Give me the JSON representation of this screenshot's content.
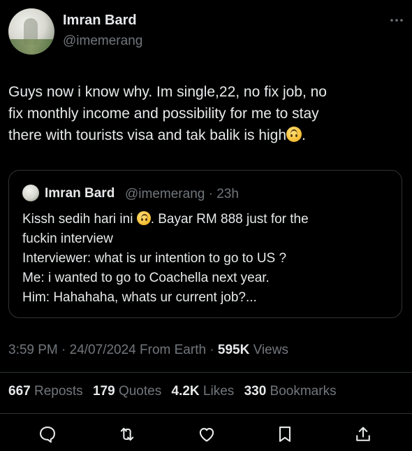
{
  "author": {
    "name": "Imran Bard",
    "handle": "@imemerang"
  },
  "tweet": {
    "lines": [
      "Guys now i know why. Im single,22, no fix job, no",
      "fix monthly income and possibility for me to stay",
      "there with tourists visa and tak balik is high"
    ],
    "line3_tail": ".",
    "emoji": "upside-down-face-emoji"
  },
  "quoted": {
    "name": "Imran Bard",
    "handle_time": "@imemerang · 23h",
    "line1_pre": "Kissh sedih hari ini",
    "line1_post": ". Bayar RM 888 just for the",
    "lines": [
      "fuckin interview",
      "Interviewer: what is ur intention to go to US ?",
      "Me: i wanted to go to Coachella next year.",
      "Him: Hahahaha, whats ur current job?..."
    ]
  },
  "meta": {
    "time_date_source": "3:59 PM · 24/07/2024 From Earth · ",
    "views_count": "595K",
    "views_label": "Views"
  },
  "stats": {
    "reposts_count": "667",
    "reposts_label": "Reposts",
    "quotes_count": "179",
    "quotes_label": "Quotes",
    "likes_count": "4.2K",
    "likes_label": "Likes",
    "bookmarks_count": "330",
    "bookmarks_label": "Bookmarks"
  },
  "actions": [
    "reply-icon",
    "repost-icon",
    "like-icon",
    "bookmark-icon",
    "share-icon"
  ],
  "colors": {
    "background": "#000000",
    "primary_text": "#e7e9ea",
    "secondary_text": "#71767b",
    "border": "#2f3336"
  }
}
